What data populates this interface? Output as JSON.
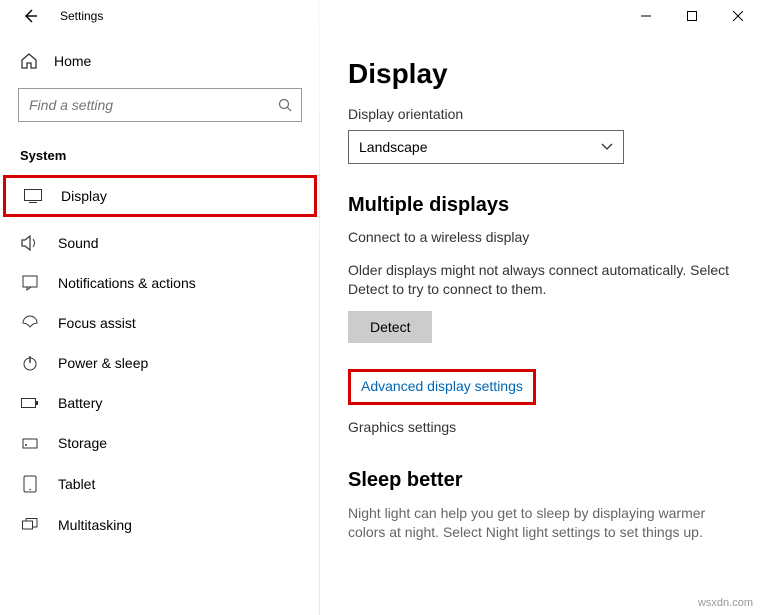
{
  "window": {
    "title": "Settings"
  },
  "sidebar": {
    "home": "Home",
    "search_placeholder": "Find a setting",
    "section": "System",
    "items": [
      {
        "label": "Display"
      },
      {
        "label": "Sound"
      },
      {
        "label": "Notifications & actions"
      },
      {
        "label": "Focus assist"
      },
      {
        "label": "Power & sleep"
      },
      {
        "label": "Battery"
      },
      {
        "label": "Storage"
      },
      {
        "label": "Tablet"
      },
      {
        "label": "Multitasking"
      }
    ]
  },
  "content": {
    "title": "Display",
    "orientation_label": "Display orientation",
    "orientation_value": "Landscape",
    "multi_heading": "Multiple displays",
    "wireless_link": "Connect to a wireless display",
    "detect_text": "Older displays might not always connect automatically. Select Detect to try to connect to them.",
    "detect_btn": "Detect",
    "advanced_link": "Advanced display settings",
    "graphics_link": "Graphics settings",
    "sleep_heading": "Sleep better",
    "sleep_text": "Night light can help you get to sleep by displaying warmer colors at night. Select Night light settings to set things up."
  },
  "watermark": "wsxdn.com"
}
